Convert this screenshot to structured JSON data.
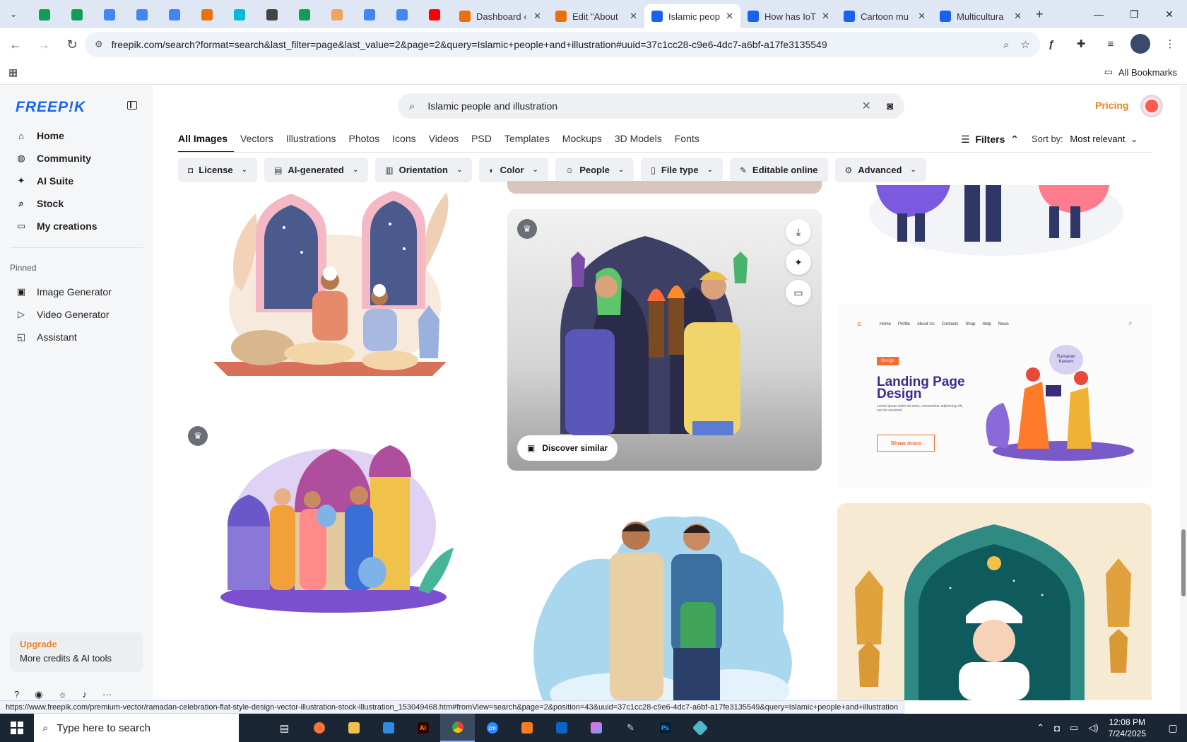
{
  "browser": {
    "pinned_tab_colors": [
      "#0f9d58",
      "#0f9d58",
      "#4285f4",
      "#4285f4",
      "#4285f4",
      "#e8710a",
      "#00bcd4",
      "#444444",
      "#0f9d58",
      "#f4a261",
      "#4285f4",
      "#4285f4",
      "#ff0000"
    ],
    "tabs": [
      {
        "label": "Dashboard ‹",
        "icon": "xampp-icon",
        "color": "#e8710a"
      },
      {
        "label": "Edit \"About",
        "icon": "xampp-icon",
        "color": "#e8710a"
      },
      {
        "label": "Islamic peop",
        "icon": "freepik-icon",
        "color": "#1762f3",
        "active": true
      },
      {
        "label": "How has IoT",
        "icon": "freepik-icon",
        "color": "#1762f3"
      },
      {
        "label": "Cartoon mu",
        "icon": "freepik-icon",
        "color": "#1762f3"
      },
      {
        "label": "Multicultura",
        "icon": "freepik-icon",
        "color": "#1762f3"
      }
    ],
    "url": "freepik.com/search?format=search&last_filter=page&last_value=2&page=2&query=Islamic+people+and+illustration#uuid=37c1cc28-c9e6-4dc7-a6bf-a17fe3135549",
    "all_bookmarks": "All Bookmarks",
    "status_url": "https://www.freepik.com/premium-vector/ramadan-celebration-flat-style-design-vector-illustration-stock-illustration_153049468.htm#fromView=search&page=2&position=43&uuid=37c1cc28-c9e6-4dc7-a6bf-a17fe3135549&query=Islamic+people+and+illustration"
  },
  "sidebar": {
    "logo": "FREEP!K",
    "nav": [
      {
        "label": "Home",
        "icon": "home-icon",
        "glyph": "⌂"
      },
      {
        "label": "Community",
        "icon": "globe-icon",
        "glyph": "◍"
      },
      {
        "label": "AI Suite",
        "icon": "sparkle-icon",
        "glyph": "✦"
      },
      {
        "label": "Stock",
        "icon": "search-icon",
        "glyph": "⌕"
      },
      {
        "label": "My creations",
        "icon": "folder-icon",
        "glyph": "▭"
      }
    ],
    "pinned_label": "Pinned",
    "pinned": [
      {
        "label": "Image Generator",
        "icon": "image-icon",
        "glyph": "▣"
      },
      {
        "label": "Video Generator",
        "icon": "video-icon",
        "glyph": "▷"
      },
      {
        "label": "Assistant",
        "icon": "chat-icon",
        "glyph": "◱"
      }
    ],
    "upgrade": {
      "title": "Upgrade",
      "subtitle": "More credits & AI tools"
    }
  },
  "search": {
    "query": "Islamic people and illustration"
  },
  "header": {
    "pricing": "Pricing"
  },
  "type_tabs": [
    "All Images",
    "Vectors",
    "Illustrations",
    "Photos",
    "Icons",
    "Videos",
    "PSD",
    "Templates",
    "Mockups",
    "3D Models",
    "Fonts"
  ],
  "filters_label": "Filters",
  "sort": {
    "label": "Sort by:",
    "value": "Most relevant"
  },
  "filter_chips": [
    {
      "label": "License",
      "glyph": "◘",
      "dropdown": true
    },
    {
      "label": "AI-generated",
      "glyph": "▤",
      "dropdown": true
    },
    {
      "label": "Orientation",
      "glyph": "▥",
      "dropdown": true
    },
    {
      "label": "Color",
      "glyph": "◐",
      "dropdown": true
    },
    {
      "label": "People",
      "glyph": "☺",
      "dropdown": true
    },
    {
      "label": "File type",
      "glyph": "▯",
      "dropdown": true
    },
    {
      "label": "Editable online",
      "glyph": "✎",
      "dropdown": false
    },
    {
      "label": "Advanced",
      "glyph": "⚙",
      "dropdown": true
    }
  ],
  "card": {
    "discover_similar": "Discover similar"
  },
  "landing_preview": {
    "nav": [
      "Home",
      "Profile",
      "About Us",
      "Contacts",
      "Shop",
      "Help",
      "News"
    ],
    "tag": "Design",
    "title": "Landing Page Design",
    "subtitle": "Lorem ipsum dolor sit amet, consectetur adipiscing elit, sed do eiusmod",
    "button": "Show more",
    "bubble": "Ramadan Kareem"
  },
  "taskbar": {
    "search_placeholder": "Type here to search",
    "time": "12:08 PM",
    "date": "7/24/2025"
  },
  "colors": {
    "brand": "#1762f3",
    "accent": "#e8872a",
    "taskbar": "#1b2635"
  }
}
